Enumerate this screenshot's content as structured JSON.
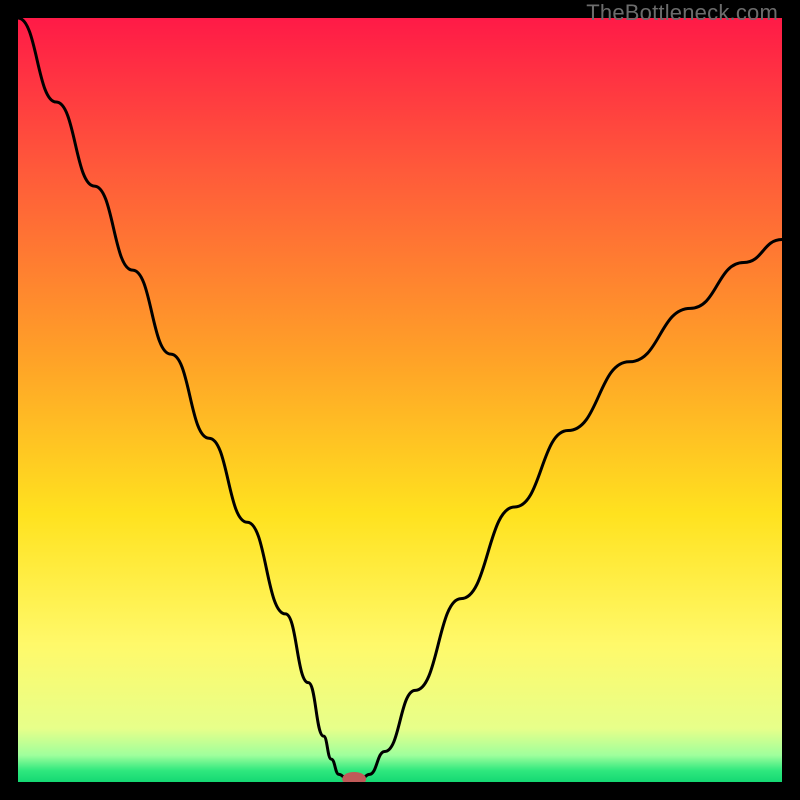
{
  "watermark": "TheBottleneck.com",
  "chart_data": {
    "type": "line",
    "title": "",
    "xlabel": "",
    "ylabel": "",
    "xlim": [
      0,
      100
    ],
    "ylim": [
      0,
      100
    ],
    "grid": false,
    "legend": false,
    "background_gradient": {
      "stops": [
        {
          "pos": 0.0,
          "color": "#ff1a47"
        },
        {
          "pos": 0.2,
          "color": "#ff5a3a"
        },
        {
          "pos": 0.45,
          "color": "#ffa327"
        },
        {
          "pos": 0.65,
          "color": "#ffe21f"
        },
        {
          "pos": 0.82,
          "color": "#fff96a"
        },
        {
          "pos": 0.93,
          "color": "#e7ff8a"
        },
        {
          "pos": 0.965,
          "color": "#9fff9c"
        },
        {
          "pos": 0.985,
          "color": "#2fe87e"
        },
        {
          "pos": 1.0,
          "color": "#14d873"
        }
      ]
    },
    "series": [
      {
        "name": "bottleneck-curve",
        "x": [
          0,
          5,
          10,
          15,
          20,
          25,
          30,
          35,
          38,
          40,
          41,
          42,
          43,
          44,
          45,
          46,
          48,
          52,
          58,
          65,
          72,
          80,
          88,
          95,
          100
        ],
        "y": [
          100,
          89,
          78,
          67,
          56,
          45,
          34,
          22,
          13,
          6,
          3,
          1,
          0.5,
          0,
          0.5,
          1,
          4,
          12,
          24,
          36,
          46,
          55,
          62,
          68,
          71
        ]
      }
    ],
    "marker": {
      "name": "optimal-point",
      "x": 44,
      "y": 0,
      "color": "#c05a58",
      "rx": 12,
      "ry": 7
    },
    "frame": {
      "outer_color": "#000000",
      "outer_thickness_px": 18
    }
  }
}
